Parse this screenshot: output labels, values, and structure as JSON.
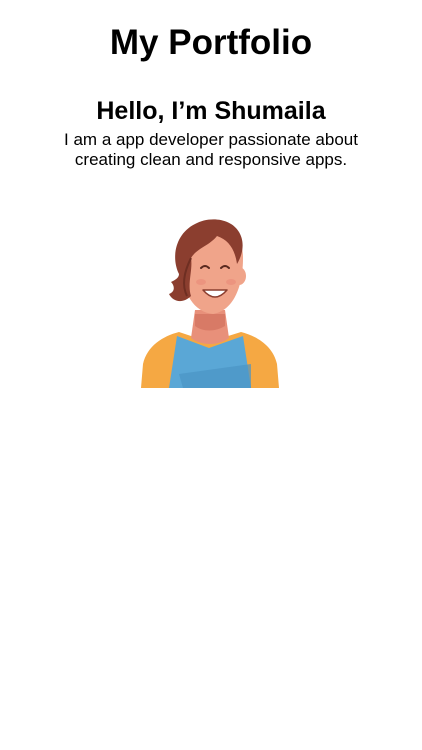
{
  "header": {
    "title": "My Portfolio"
  },
  "hero": {
    "greeting": "Hello, I’m Shumaila",
    "intro": "I am a app developer passionate about creating clean and responsive apps.",
    "avatar_icon": "developer-avatar-illustration"
  },
  "colors": {
    "background": "#ffffff",
    "text": "#000000",
    "hair": "#8b3e2f",
    "skin": "#f0a48a",
    "shirt": "#5aa7d6",
    "jacket": "#f5a843"
  }
}
